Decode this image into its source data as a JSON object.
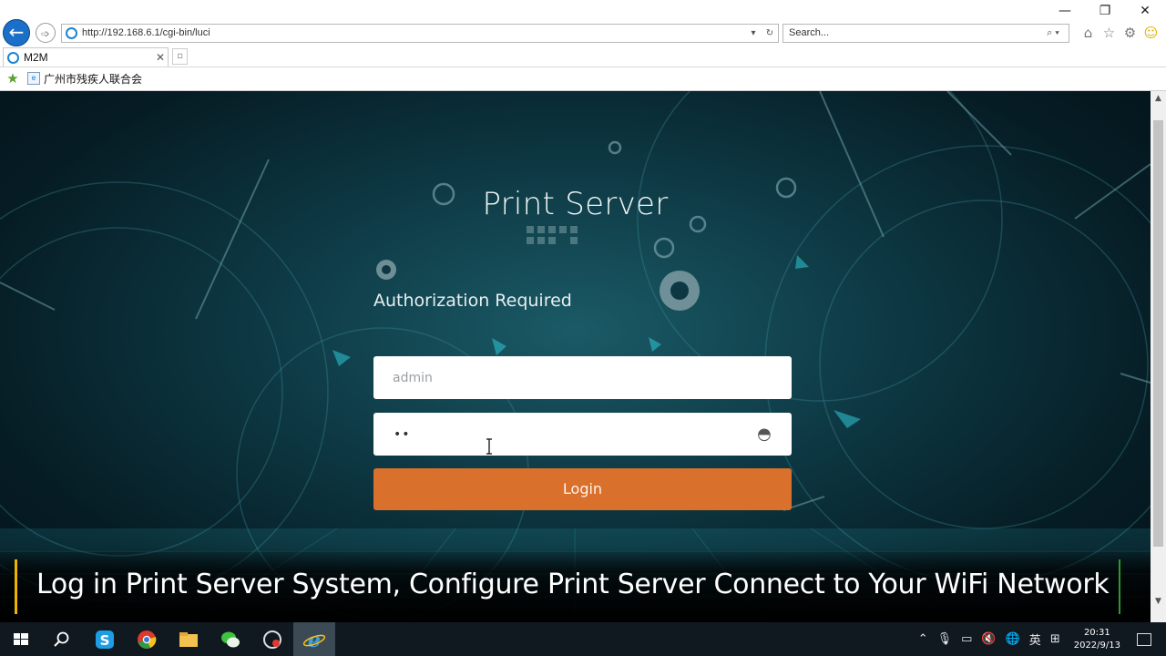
{
  "browser": {
    "window_controls": [
      "—",
      "❐",
      "✕"
    ],
    "address": "http://192.168.6.1/cgi-bin/luci",
    "search_placeholder": "Search...",
    "tab_title": "M2M",
    "favorites": [
      {
        "label": "广州市残疾人联合会"
      }
    ]
  },
  "page": {
    "title": "Print Server",
    "subtitle": "Authorization Required",
    "username_placeholder": "admin",
    "password_value": "••",
    "login_label": "Login"
  },
  "overlay": {
    "caption": "Log in Print Server System, Configure Print Server Connect to Your WiFi Network"
  },
  "taskbar": {
    "tray_lang": "英",
    "clock_time": "20:31",
    "clock_date": "2022/9/13"
  },
  "colors": {
    "login_button": "#d9702c",
    "background": "#0d3843",
    "caption_left_bar": "#f0b400",
    "caption_right_bar": "#2b9c2b"
  }
}
